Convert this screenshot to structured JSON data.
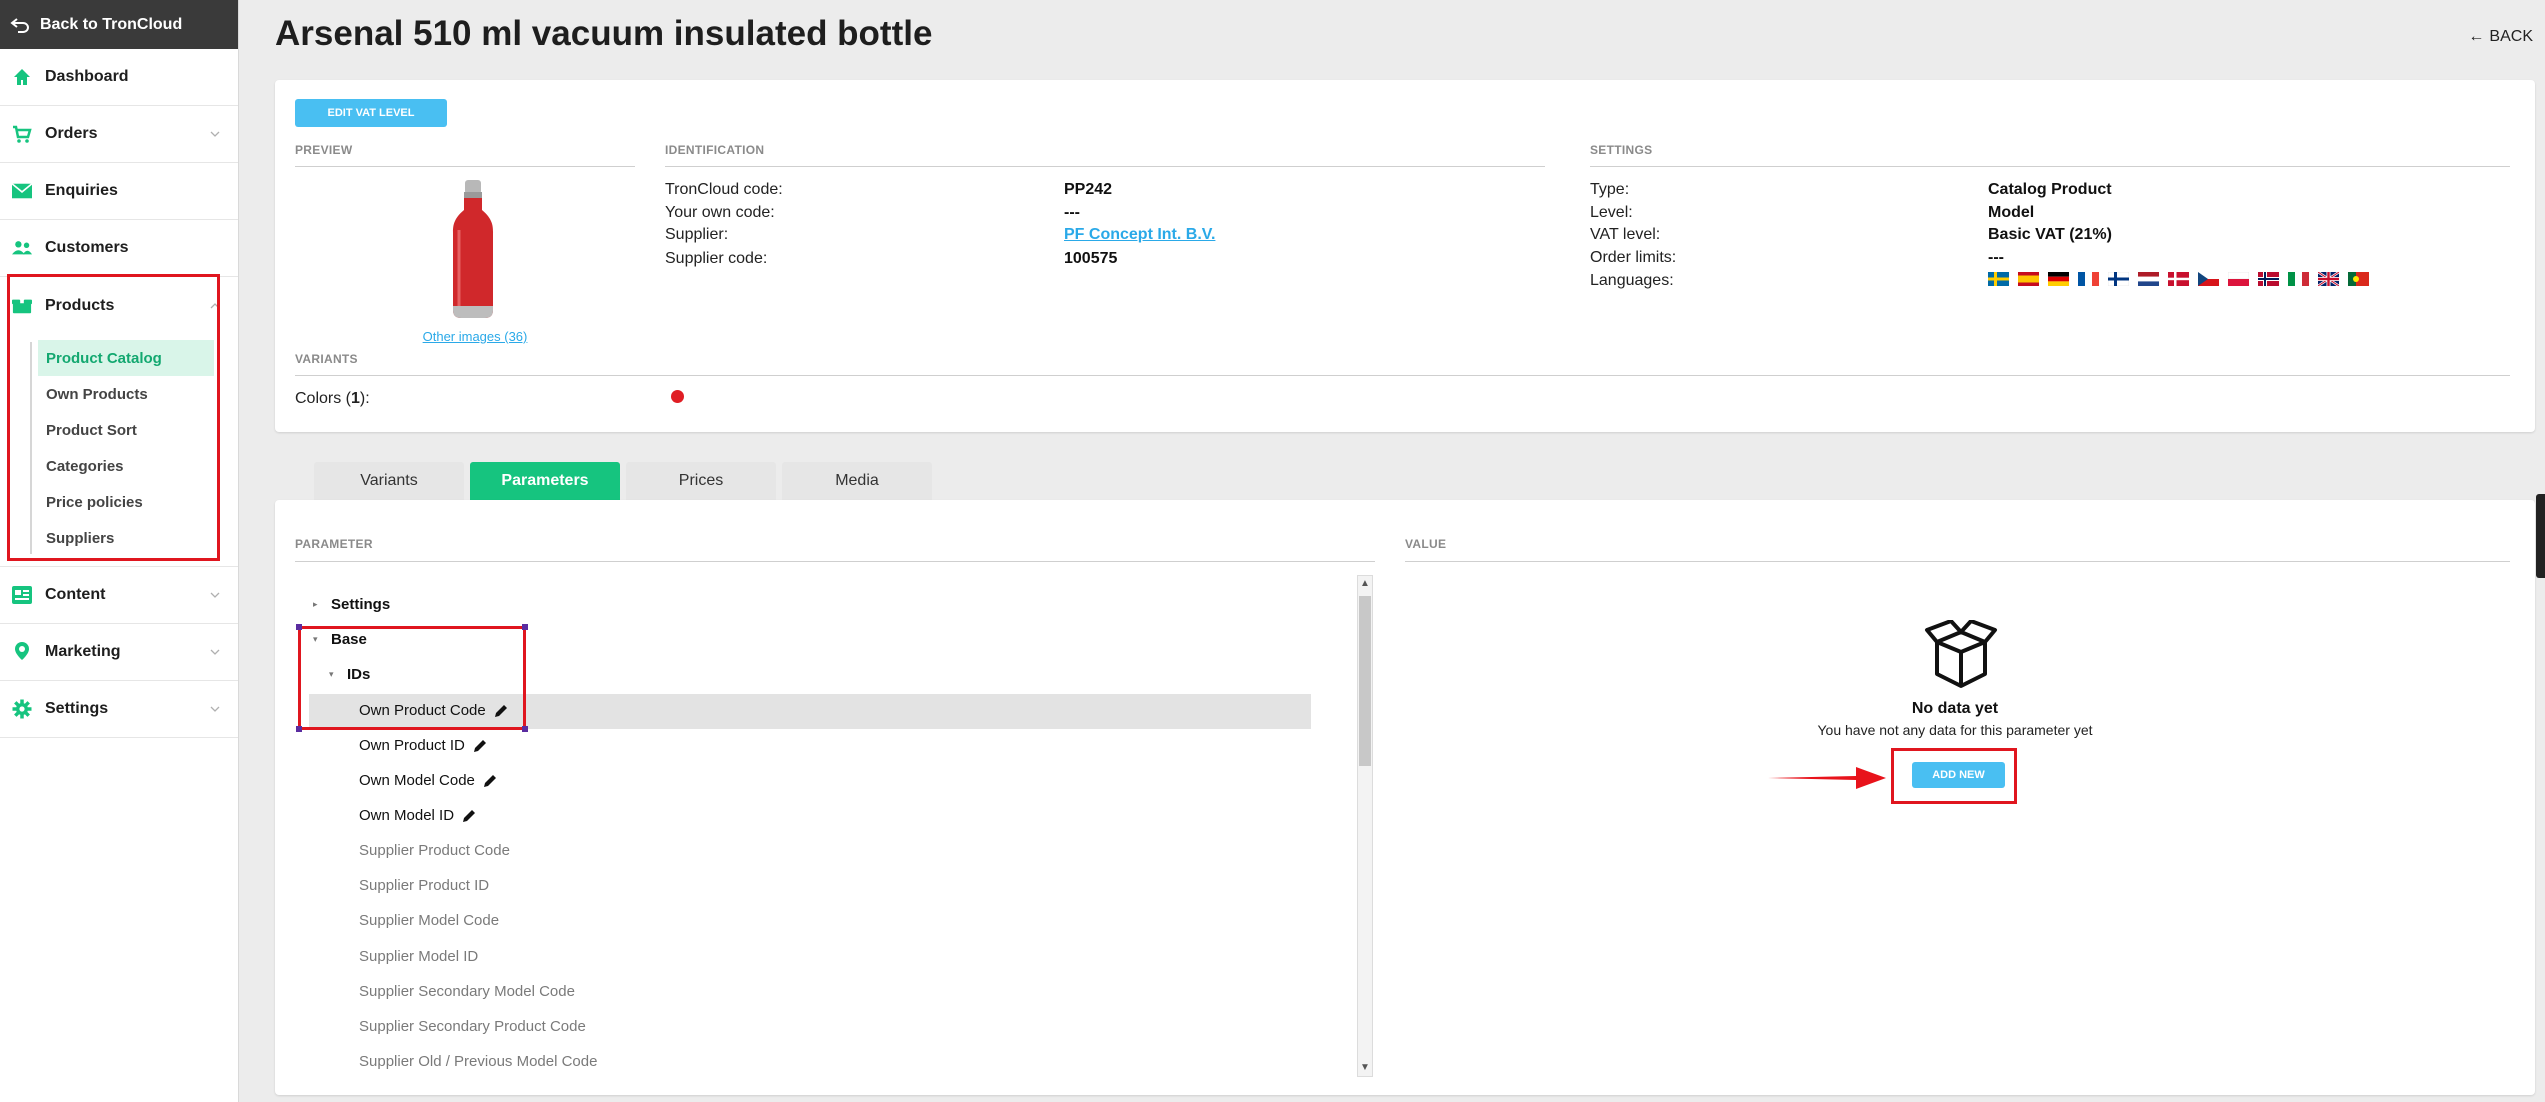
{
  "sidebar": {
    "back_label": "Back to TronCloud",
    "items": [
      {
        "label": "Dashboard",
        "icon": "home-icon"
      },
      {
        "label": "Orders",
        "icon": "cart-icon"
      },
      {
        "label": "Enquiries",
        "icon": "mail-icon"
      },
      {
        "label": "Customers",
        "icon": "users-icon"
      },
      {
        "label": "Products",
        "icon": "box-icon"
      },
      {
        "label": "Content",
        "icon": "content-icon"
      },
      {
        "label": "Marketing",
        "icon": "pin-icon"
      },
      {
        "label": "Settings",
        "icon": "gear-icon"
      }
    ],
    "products_sub": [
      "Product Catalog",
      "Own Products",
      "Product Sort",
      "Categories",
      "Price policies",
      "Suppliers"
    ],
    "accent_color": "#16c47f"
  },
  "page": {
    "title": "Arsenal 510 ml vacuum insulated bottle",
    "back_label": "BACK"
  },
  "info": {
    "edit_vat_label": "EDIT VAT LEVEL",
    "preview_label": "PREVIEW",
    "identification_label": "IDENTIFICATION",
    "settings_label": "SETTINGS",
    "variants_label": "VARIANTS",
    "other_images": "Other images (36)",
    "identification": [
      {
        "label": "TronCloud code:",
        "value": "PP242"
      },
      {
        "label": "Your own code:",
        "value": "---"
      },
      {
        "label": "Supplier:",
        "value": "PF Concept Int. B.V."
      },
      {
        "label": "Supplier code:",
        "value": "100575"
      }
    ],
    "settings": [
      {
        "label": "Type:",
        "value": "Catalog Product"
      },
      {
        "label": "Level:",
        "value": "Model"
      },
      {
        "label": "VAT level:",
        "value": "Basic VAT (21%)"
      },
      {
        "label": "Order limits:",
        "value": "---"
      },
      {
        "label": "Languages:",
        "value": ""
      }
    ],
    "colors_label": "Colors (",
    "colors_count": "1",
    "colors_suffix": "):",
    "color_swatch": "#e01e24"
  },
  "tabs": [
    "Variants",
    "Parameters",
    "Prices",
    "Media"
  ],
  "params": {
    "parameter_header": "PARAMETER",
    "value_header": "VALUE",
    "tree": [
      {
        "label": "Settings",
        "level": 0,
        "caret": "right",
        "editable": false,
        "dim": false
      },
      {
        "label": "Base",
        "level": 0,
        "caret": "down",
        "editable": false,
        "dim": false
      },
      {
        "label": "IDs",
        "level": 1,
        "caret": "down",
        "editable": false,
        "dim": false
      },
      {
        "label": "Own Product Code",
        "level": 2,
        "editable": true,
        "dim": false,
        "selected": true
      },
      {
        "label": "Own Product ID",
        "level": 2,
        "editable": true,
        "dim": false
      },
      {
        "label": "Own Model Code",
        "level": 2,
        "editable": true,
        "dim": false
      },
      {
        "label": "Own Model ID",
        "level": 2,
        "editable": true,
        "dim": false
      },
      {
        "label": "Supplier Product Code",
        "level": 2,
        "editable": false,
        "dim": true
      },
      {
        "label": "Supplier Product ID",
        "level": 2,
        "editable": false,
        "dim": true
      },
      {
        "label": "Supplier Model Code",
        "level": 2,
        "editable": false,
        "dim": true
      },
      {
        "label": "Supplier Model ID",
        "level": 2,
        "editable": false,
        "dim": true
      },
      {
        "label": "Supplier Secondary Model Code",
        "level": 2,
        "editable": false,
        "dim": true
      },
      {
        "label": "Supplier Secondary Product Code",
        "level": 2,
        "editable": false,
        "dim": true
      },
      {
        "label": "Supplier Old / Previous Model Code",
        "level": 2,
        "editable": false,
        "dim": true
      }
    ],
    "no_data_title": "No data yet",
    "no_data_text": "You have not any data for this parameter yet",
    "add_new_label": "ADD NEW"
  },
  "flags": [
    "se",
    "es",
    "de",
    "fr",
    "fi",
    "nl",
    "dk",
    "cz",
    "pl",
    "no",
    "it",
    "gb",
    "pt"
  ]
}
